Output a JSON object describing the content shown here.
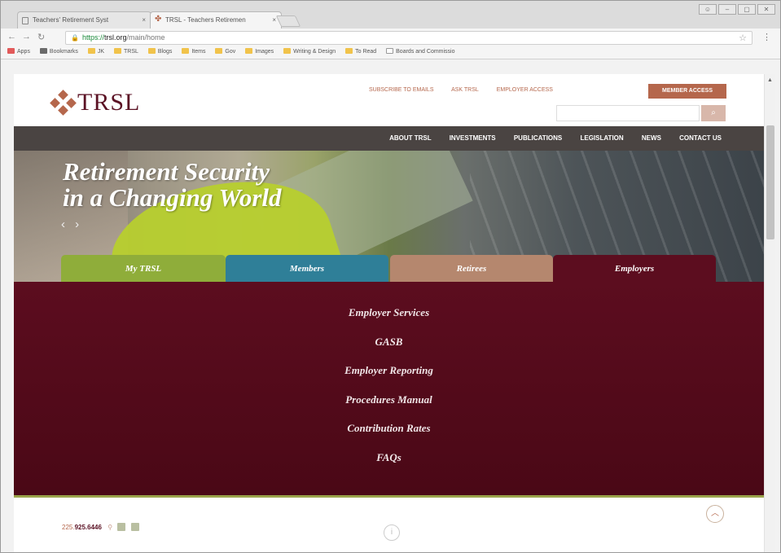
{
  "browser": {
    "tabs": [
      {
        "title": "Teachers' Retirement Syst"
      },
      {
        "title": "TRSL - Teachers Retiremen"
      }
    ],
    "url_https": "https://",
    "url_host": "trsl.org",
    "url_path": "/main/home",
    "bookmarks": [
      "Apps",
      "Bookmarks",
      "JK",
      "TRSL",
      "Blogs",
      "Items",
      "Gov",
      "Images",
      "Writing & Design",
      "To Read",
      "Boards and Commissio"
    ]
  },
  "site": {
    "logo": "TRSL",
    "top_links": [
      "Subscribe to Emails",
      "Ask TRSL",
      "Employer Access"
    ],
    "member_access": "Member Access",
    "nav": [
      "About TRSL",
      "Investments",
      "Publications",
      "Legislation",
      "News",
      "Contact Us"
    ],
    "hero_line1": "Retirement Security",
    "hero_line2": "in a Changing World",
    "hero_arrows": "‹ ›",
    "tabs": [
      {
        "label": "My TRSL",
        "color": "#8fad3a"
      },
      {
        "label": "Members",
        "color": "#2f7f98"
      },
      {
        "label": "Retirees",
        "color": "#b5876e"
      },
      {
        "label": "Employers",
        "color": "#5c0d1f"
      }
    ],
    "employer_links": [
      "Employer Services",
      "GASB",
      "Employer Reporting",
      "Procedures Manual",
      "Contribution Rates",
      "FAQs"
    ],
    "phone_prefix": "225.",
    "phone_rest": "925.6446"
  }
}
